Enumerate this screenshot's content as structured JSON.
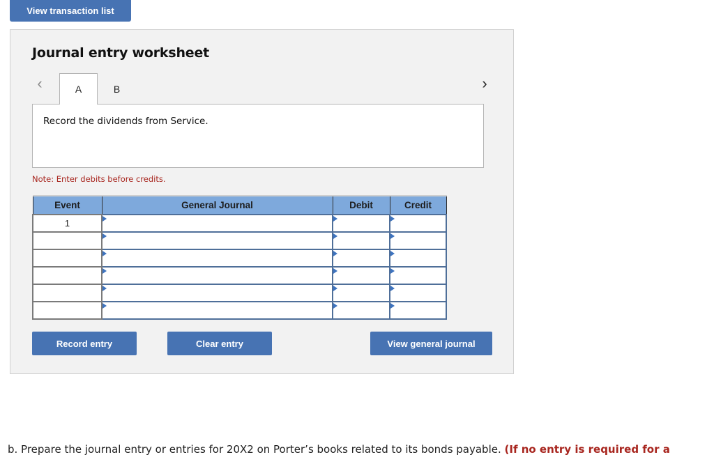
{
  "top_button": {
    "label": "View transaction list"
  },
  "worksheet": {
    "title": "Journal entry worksheet",
    "nav": {
      "prev_icon": "chevron-left-icon",
      "next_icon": "chevron-right-icon",
      "prev_glyph": "‹",
      "next_glyph": "›"
    },
    "tabs": [
      {
        "label": "A",
        "active": true
      },
      {
        "label": "B",
        "active": false
      }
    ],
    "description": "Record the dividends from Service.",
    "note": "Note: Enter debits before credits.",
    "table": {
      "columns": [
        "Event",
        "General Journal",
        "Debit",
        "Credit"
      ],
      "rows": [
        {
          "event": "1",
          "account": "",
          "debit": "",
          "credit": ""
        },
        {
          "event": "",
          "account": "",
          "debit": "",
          "credit": ""
        },
        {
          "event": "",
          "account": "",
          "debit": "",
          "credit": ""
        },
        {
          "event": "",
          "account": "",
          "debit": "",
          "credit": ""
        },
        {
          "event": "",
          "account": "",
          "debit": "",
          "credit": ""
        },
        {
          "event": "",
          "account": "",
          "debit": "",
          "credit": ""
        }
      ]
    },
    "buttons": {
      "record": "Record entry",
      "clear": "Clear entry",
      "view_general_journal": "View general journal"
    }
  },
  "part_b": {
    "text": "b. Prepare the journal entry or entries for 20X2 on Porter’s books related to its bonds payable. ",
    "instruction": "(If no entry is required for a"
  },
  "colors": {
    "button_blue": "#4773b3",
    "header_blue": "#7ea9dc",
    "note_red": "#a8261f",
    "panel_bg": "#f2f2f2"
  }
}
